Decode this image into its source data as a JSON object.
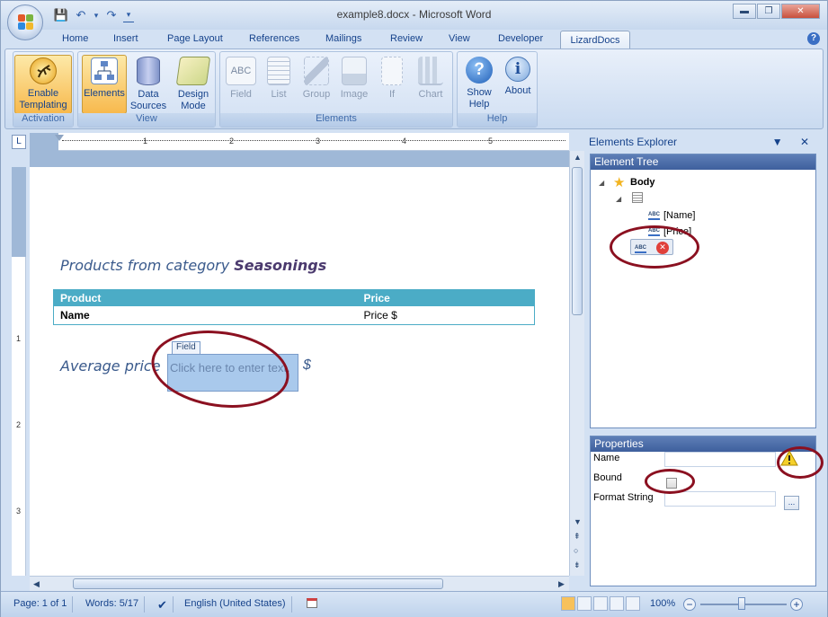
{
  "window": {
    "title": "example8.docx - Microsoft Word",
    "controls": {
      "minimize": "▬",
      "restore": "❐",
      "close": "✕"
    }
  },
  "qat": {
    "save": "💾",
    "undo": "↶",
    "undo_drop": "▾",
    "redo": "↷",
    "customize": "▾"
  },
  "tabs": [
    "Home",
    "Insert",
    "Page Layout",
    "References",
    "Mailings",
    "Review",
    "View",
    "Developer",
    "LizardDocs"
  ],
  "active_tab": "LizardDocs",
  "help_glyph": "?",
  "ribbon": {
    "groups": [
      {
        "label": "Activation",
        "buttons": [
          {
            "label": "Enable Templating",
            "icon": "lizard-icon",
            "state": "active"
          }
        ]
      },
      {
        "label": "View",
        "buttons": [
          {
            "label": "Elements",
            "icon": "elements-icon",
            "state": "active"
          },
          {
            "label": "Data Sources",
            "icon": "database-icon",
            "state": "enabled"
          },
          {
            "label": "Design Mode",
            "icon": "design-mode-icon",
            "state": "enabled"
          }
        ]
      },
      {
        "label": "Elements",
        "buttons": [
          {
            "label": "Field",
            "icon": "abc-field-icon",
            "state": "disabled"
          },
          {
            "label": "List",
            "icon": "list-icon",
            "state": "disabled"
          },
          {
            "label": "Group",
            "icon": "group-icon",
            "state": "disabled"
          },
          {
            "label": "Image",
            "icon": "image-icon",
            "state": "disabled"
          },
          {
            "label": "If",
            "icon": "if-icon",
            "state": "disabled"
          },
          {
            "label": "Chart",
            "icon": "chart-icon",
            "state": "disabled"
          }
        ]
      },
      {
        "label": "Help",
        "buttons": [
          {
            "label": "Show Help",
            "icon": "help-circle-icon",
            "state": "enabled"
          },
          {
            "label": "About",
            "icon": "info-icon",
            "state": "enabled"
          }
        ]
      }
    ]
  },
  "ruler": {
    "corner": "L",
    "ticks": [
      "1",
      "2",
      "3",
      "4",
      "5"
    ],
    "vticks": [
      "1",
      "2",
      "3"
    ]
  },
  "document": {
    "heading_prefix": "Products from  category",
    "heading_category": "Seasonings",
    "table": {
      "headers": [
        "Product",
        "Price"
      ],
      "rows": [
        [
          "Name",
          "Price $"
        ]
      ]
    },
    "average_label": "Average price",
    "field_tag": "Field",
    "field_placeholder": "Click here to enter text.",
    "currency": "$"
  },
  "explorer": {
    "title": "Elements Explorer",
    "pane_controls": "▼ ✕",
    "tree_title": "Element Tree",
    "tree": {
      "root": "Body",
      "children": [
        "[Name]",
        "[Price]"
      ]
    },
    "properties_title": "Properties",
    "properties": {
      "name_label": "Name",
      "bound_label": "Bound",
      "format_label": "Format String",
      "ellipsis": "..."
    }
  },
  "statusbar": {
    "page": "Page: 1 of 1",
    "words": "Words: 5/17",
    "language": "English (United States)",
    "zoom": "100%",
    "zoom_out": "−",
    "zoom_in": "+"
  },
  "colors": {
    "table_header": "#4bacc6",
    "annotation_ring": "#8b1020",
    "active_button": "#f7b94d"
  }
}
